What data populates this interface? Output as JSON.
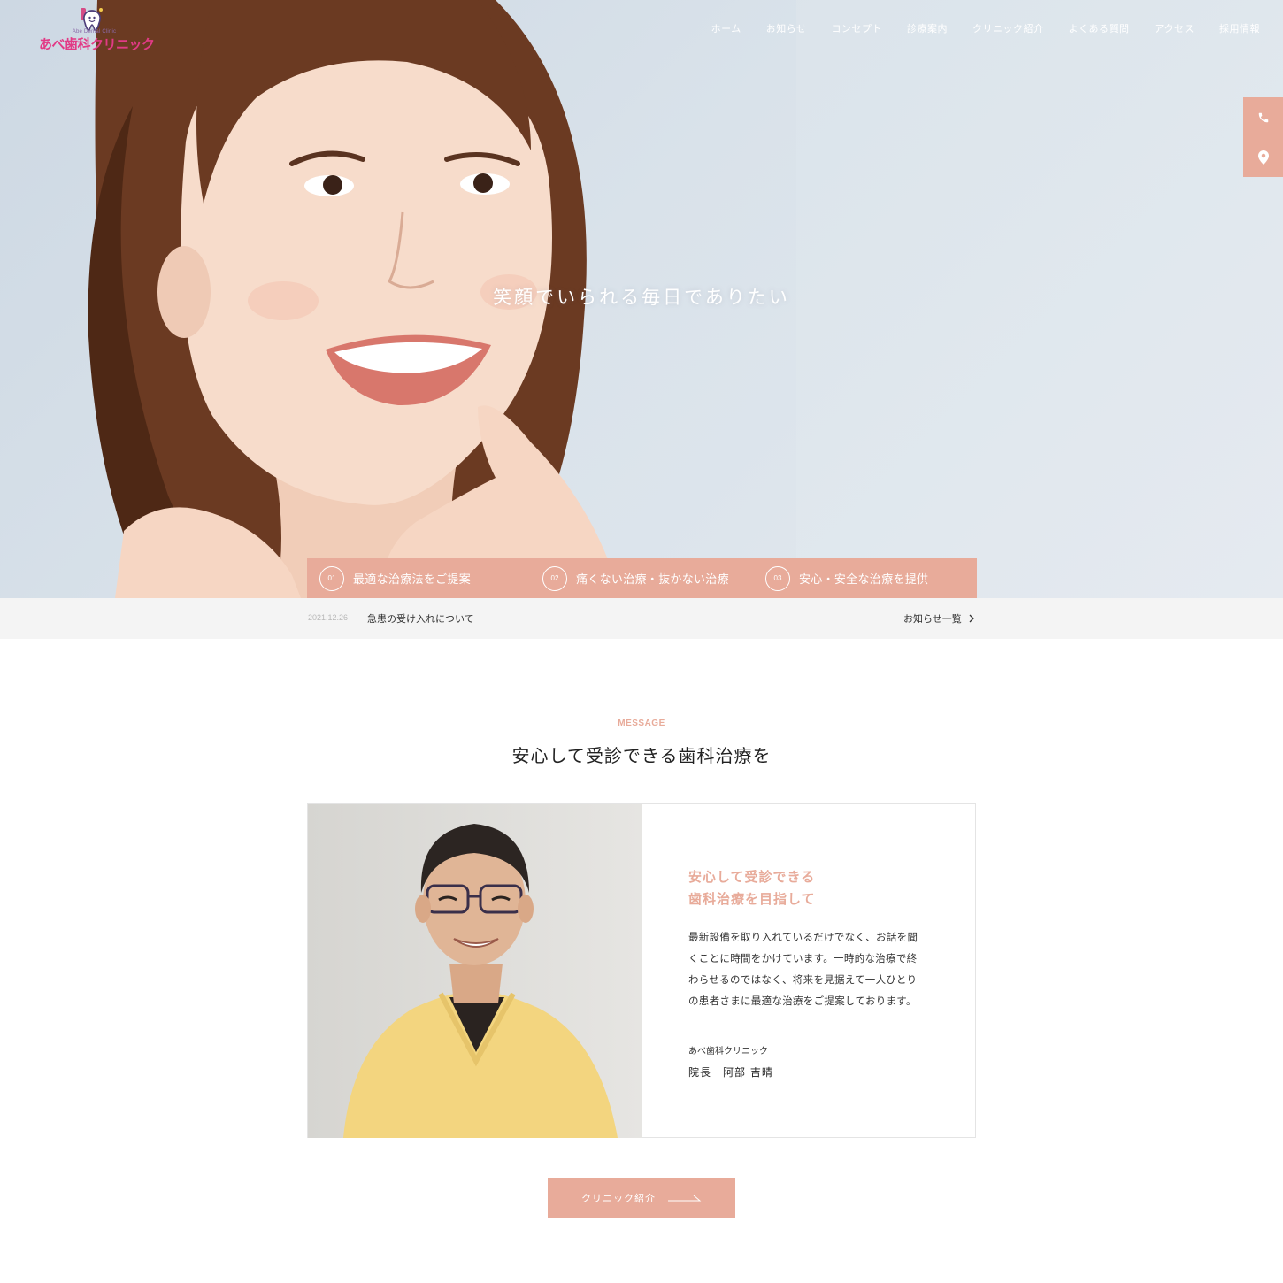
{
  "header": {
    "logo_sub": "Abe Dental Clinic",
    "logo_text": "あべ歯科クリニック",
    "nav": [
      "ホーム",
      "お知らせ",
      "コンセプト",
      "診療案内",
      "クリニック紹介",
      "よくある質問",
      "アクセス",
      "採用情報"
    ]
  },
  "side": {
    "phone_icon": "phone-icon",
    "map_icon": "map-pin-icon"
  },
  "hero": {
    "copy": "笑顔でいられる毎日でありたい",
    "features": [
      {
        "num": "01",
        "text": "最適な治療法をご提案"
      },
      {
        "num": "02",
        "text": "痛くない治療・抜かない治療"
      },
      {
        "num": "03",
        "text": "安心・安全な治療を提供"
      }
    ]
  },
  "news": {
    "date": "2021.12.26",
    "title": "急患の受け入れについて",
    "more": "お知らせ一覧"
  },
  "message": {
    "label": "MESSAGE",
    "heading": "安心して受診できる歯科治療を",
    "title_line1": "安心して受診できる",
    "title_line2": "歯科治療を目指して",
    "body_lines": [
      "最新設備を取り入れているだけでなく、お話を聞",
      "くことに時間をかけています。一時的な治療で終",
      "わらせるのではなく、将来を見据えて一人ひとり",
      "の患者さまに最適な治療をご提案しております。"
    ],
    "clinic": "あべ歯科クリニック",
    "name": "院長　阿部 吉晴",
    "button": "クリニック紹介"
  },
  "colors": {
    "accent": "#e8ab9a",
    "logo": "#e23a86"
  }
}
